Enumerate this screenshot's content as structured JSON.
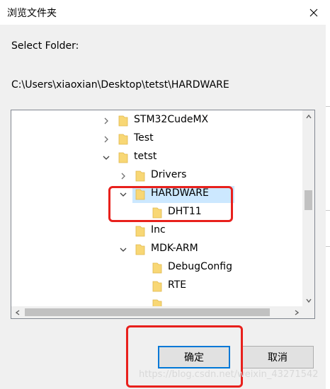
{
  "window": {
    "title": "浏览文件夹"
  },
  "dialog": {
    "prompt_label": "Select Folder:",
    "current_path": "C:\\Users\\xiaoxian\\Desktop\\tetst\\HARDWARE"
  },
  "tree": {
    "nodes": [
      {
        "label": "STM32CudeMX",
        "state": "collapsed"
      },
      {
        "label": "Test",
        "state": "collapsed"
      },
      {
        "label": "tetst",
        "state": "expanded"
      },
      {
        "label": "Drivers",
        "state": "collapsed"
      },
      {
        "label": "HARDWARE",
        "state": "expanded",
        "selected": true
      },
      {
        "label": "DHT11",
        "state": "leaf"
      },
      {
        "label": "Inc",
        "state": "leaf"
      },
      {
        "label": "MDK-ARM",
        "state": "expanded"
      },
      {
        "label": "DebugConfig",
        "state": "leaf"
      },
      {
        "label": "RTE",
        "state": "leaf"
      }
    ]
  },
  "buttons": {
    "ok_label": "确定",
    "cancel_label": "取消"
  },
  "watermark": "https://blog.csdn.net/weixin_43271542",
  "colors": {
    "selection": "#cce8ff",
    "folder": "#f8d775",
    "annotation": "#e8201c",
    "default_button_border": "#0078d7"
  }
}
